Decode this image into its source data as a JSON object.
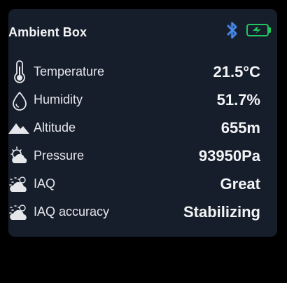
{
  "card": {
    "title": "Ambient Box",
    "status_icons": [
      "bluetooth-icon",
      "battery-charging-icon"
    ]
  },
  "readings": [
    {
      "icon": "thermometer-icon",
      "label": "Temperature",
      "value": "21.5°C"
    },
    {
      "icon": "droplet-icon",
      "label": "Humidity",
      "value": "51.7%"
    },
    {
      "icon": "mountain-icon",
      "label": "Altitude",
      "value": "655m"
    },
    {
      "icon": "sun-cloud-icon",
      "label": "Pressure",
      "value": "93950Pa"
    },
    {
      "icon": "haze-cloud-icon",
      "label": "IAQ",
      "value": "Great"
    },
    {
      "icon": "haze-cloud-icon",
      "label": "IAQ accuracy",
      "value": "Stabilizing"
    }
  ],
  "colors": {
    "background": "#000000",
    "card": "#161d2b",
    "bluetooth": "#3b82f6",
    "battery": "#22c55e",
    "text": "#f3f4f6"
  }
}
